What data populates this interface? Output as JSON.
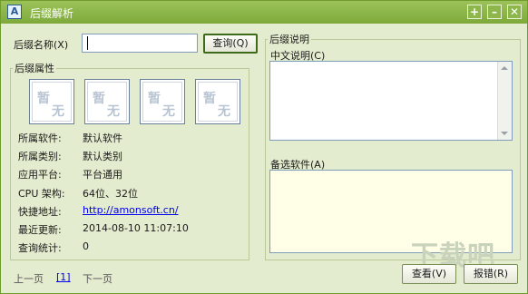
{
  "window": {
    "title": "后缀解析",
    "title_icon_glyph": "A",
    "buttons": [
      "+",
      "–",
      "✕"
    ]
  },
  "search": {
    "label": "后缀名称(X)",
    "value": "",
    "button": "查询(Q)"
  },
  "attributes": {
    "legend": "后缀属性",
    "seal_text": [
      "暂",
      "无"
    ],
    "rows": [
      {
        "label": "所属软件:",
        "value": "默认软件"
      },
      {
        "label": "所属类别:",
        "value": "默认类别"
      },
      {
        "label": "应用平台:",
        "value": "平台通用"
      },
      {
        "label": "CPU 架构:",
        "value": "64位、32位"
      },
      {
        "label": "快捷地址:",
        "value": "http://amonsoft.cn/",
        "link": true
      },
      {
        "label": "最近更新:",
        "value": "2014-08-10 11:07:10"
      },
      {
        "label": "查询统计:",
        "value": "0"
      }
    ]
  },
  "pager": {
    "prev": "上一页",
    "current": "[1]",
    "next": "下一页"
  },
  "description": {
    "legend": "后缀说明",
    "chinese_label": "中文说明(C)",
    "alt_software_label": "备选软件(A)"
  },
  "footer": {
    "view_button": "查看(V)",
    "report_button": "报错(R)"
  },
  "watermark": "下载吧",
  "colors": {
    "titlebar": "#8db74b",
    "background": "#e3ecce",
    "link": "#0000ee"
  }
}
